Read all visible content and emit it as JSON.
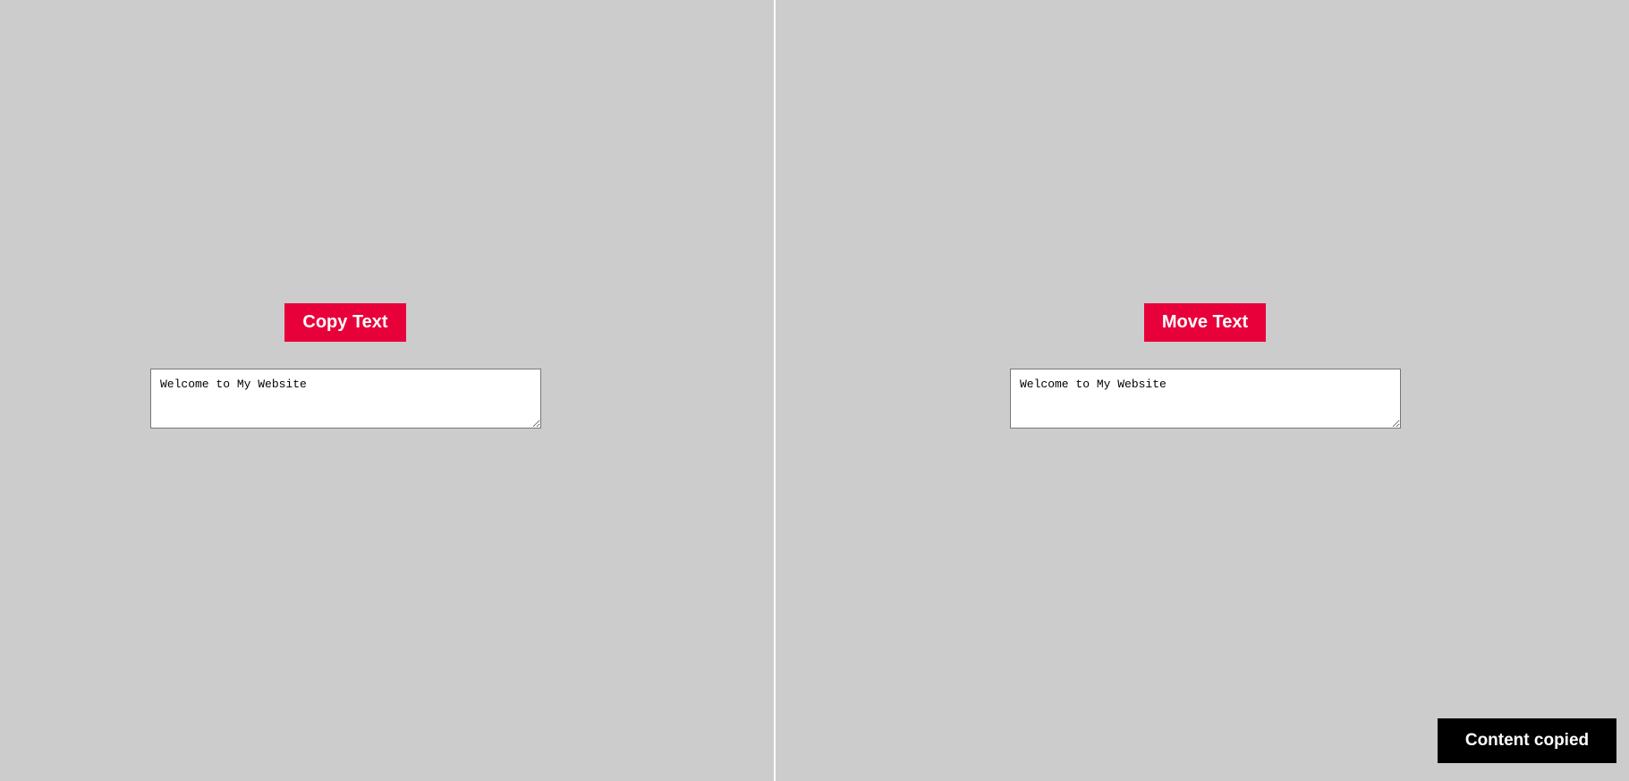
{
  "left_panel": {
    "button_label": "Copy Text",
    "textarea_value": "Welcome to My Website"
  },
  "right_panel": {
    "button_label": "Move Text",
    "textarea_value": "Welcome to My Website"
  },
  "toast": {
    "message": "Content copied"
  },
  "colors": {
    "background": "#cccccc",
    "button": "#e8003a",
    "button_text": "#ffffff",
    "divider": "#ffffff",
    "toast_background": "#000000",
    "toast_text": "#ffffff"
  }
}
